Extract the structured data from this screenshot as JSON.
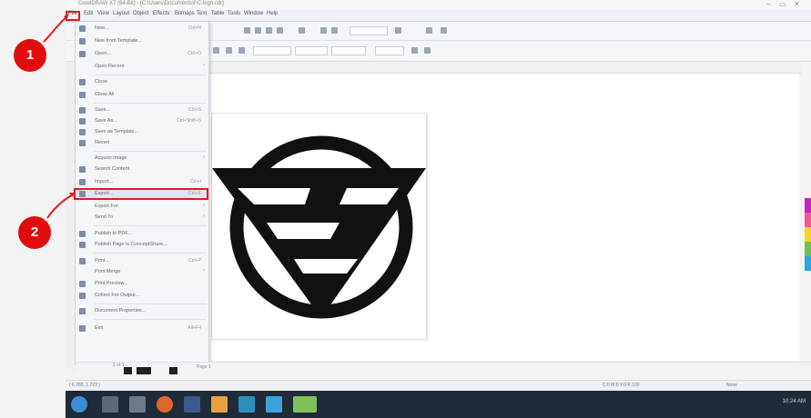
{
  "window": {
    "title": "CorelDRAW X7 (64-Bit) - [C:\\Users\\Documents\\FC-logo.cdr]",
    "controls": [
      "–",
      "▭",
      "✕"
    ]
  },
  "menubar": [
    "File",
    "Edit",
    "View",
    "Layout",
    "Object",
    "Effects",
    "Bitmaps",
    "Text",
    "Table",
    "Tools",
    "Window",
    "Help"
  ],
  "file_menu": {
    "items": [
      {
        "label": "New...",
        "shortcut": "Ctrl+N"
      },
      {
        "label": "New from Template...",
        "shortcut": ""
      },
      {
        "label": "Open...",
        "shortcut": "Ctrl+O"
      },
      {
        "label": "Open Recent",
        "shortcut": ""
      },
      {
        "label": "Close",
        "shortcut": ""
      },
      {
        "label": "Close All",
        "shortcut": ""
      },
      {
        "label": "Save...",
        "shortcut": "Ctrl+S"
      },
      {
        "label": "Save As...",
        "shortcut": "Ctrl+Shift+S"
      },
      {
        "label": "Save as Template...",
        "shortcut": ""
      },
      {
        "label": "Revert",
        "shortcut": ""
      },
      {
        "label": "Acquire Image",
        "shortcut": ""
      },
      {
        "label": "Search Content",
        "shortcut": ""
      },
      {
        "label": "Import...",
        "shortcut": "Ctrl+I"
      },
      {
        "label": "Export...",
        "shortcut": "Ctrl+E"
      },
      {
        "label": "Export For",
        "shortcut": ""
      },
      {
        "label": "Send To",
        "shortcut": ""
      },
      {
        "label": "Publish to PDF...",
        "shortcut": ""
      },
      {
        "label": "Publish Page to ConceptShare...",
        "shortcut": ""
      },
      {
        "label": "Print...",
        "shortcut": "Ctrl+P"
      },
      {
        "label": "Print Merge",
        "shortcut": ""
      },
      {
        "label": "Print Preview...",
        "shortcut": ""
      },
      {
        "label": "Collect For Output...",
        "shortcut": ""
      },
      {
        "label": "Document Properties...",
        "shortcut": ""
      },
      {
        "label": "Exit",
        "shortcut": "Alt+F4"
      }
    ]
  },
  "annotations": {
    "step1": "1",
    "step2": "2"
  },
  "pagenav": {
    "page_label": "1 of 1",
    "page_tab": "Page 1"
  },
  "statusbar": {
    "coords": "( 6.783, 1.723 )",
    "fill": "C:0 M:0 Y:0 K:100",
    "outline": "None"
  },
  "tray": {
    "time": "10:24 AM"
  },
  "colors": {
    "accent_red": "#e41b1b",
    "badge_red": "#e20c0c",
    "logo_black": "#111111",
    "taskbar": "#1f2b38"
  }
}
